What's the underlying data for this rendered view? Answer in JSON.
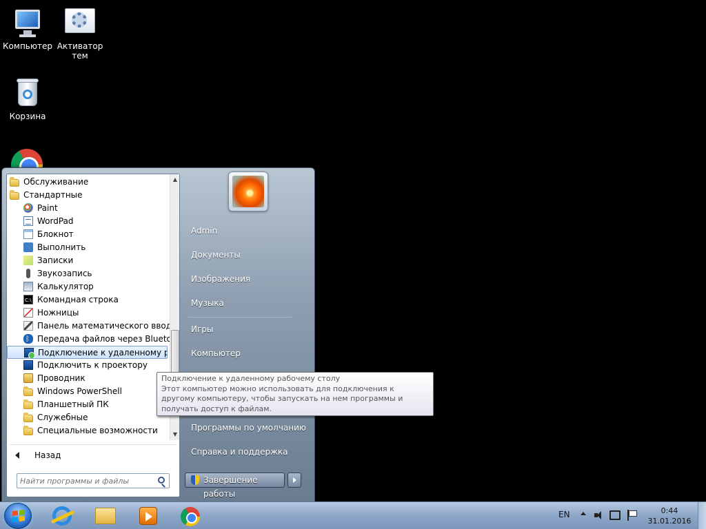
{
  "desktop": {
    "icons": [
      {
        "label": "Компьютер"
      },
      {
        "label": "Активатор тем"
      },
      {
        "label": "Корзина"
      }
    ]
  },
  "start_menu": {
    "programs": [
      {
        "label": "Обслуживание",
        "icon": "folder-icon",
        "level": 0
      },
      {
        "label": "Стандартные",
        "icon": "folder-icon",
        "level": 0
      },
      {
        "label": "Paint",
        "icon": "paint-icon",
        "level": 1
      },
      {
        "label": "WordPad",
        "icon": "wordpad-icon",
        "level": 1
      },
      {
        "label": "Блокнот",
        "icon": "notepad-icon",
        "level": 1
      },
      {
        "label": "Выполнить",
        "icon": "run-icon",
        "level": 1
      },
      {
        "label": "Записки",
        "icon": "sticky-notes-icon",
        "level": 1
      },
      {
        "label": "Звукозапись",
        "icon": "microphone-icon",
        "level": 1
      },
      {
        "label": "Калькулятор",
        "icon": "calculator-icon",
        "level": 1
      },
      {
        "label": "Командная строка",
        "icon": "command-prompt-icon",
        "level": 1
      },
      {
        "label": "Ножницы",
        "icon": "snipping-tool-icon",
        "level": 1
      },
      {
        "label": "Панель математического ввода",
        "icon": "math-input-icon",
        "level": 1
      },
      {
        "label": "Передача файлов через Bluetooth",
        "icon": "bluetooth-icon",
        "level": 1
      },
      {
        "label": "Подключение к удаленному рабочему столу",
        "icon": "remote-desktop-icon",
        "level": 1,
        "selected": true
      },
      {
        "label": "Подключить к проектору",
        "icon": "projector-icon",
        "level": 1
      },
      {
        "label": "Проводник",
        "icon": "explorer-icon",
        "level": 1
      },
      {
        "label": "Windows PowerShell",
        "icon": "folder-icon",
        "level": 1
      },
      {
        "label": "Планшетный ПК",
        "icon": "folder-icon",
        "level": 1
      },
      {
        "label": "Служебные",
        "icon": "folder-icon",
        "level": 1
      },
      {
        "label": "Специальные возможности",
        "icon": "folder-icon",
        "level": 1
      }
    ],
    "back_label": "Назад",
    "search_placeholder": "Найти программы и файлы",
    "right_items": [
      "Admin",
      "Документы",
      "Изображения",
      "Музыка",
      "Игры",
      "Компьютер",
      "Программы по умолчанию",
      "Справка и поддержка"
    ],
    "shutdown_label": "Завершение работы"
  },
  "tooltip": {
    "title": "Подключение к удаленному рабочему столу",
    "body": "Этот компьютер можно использовать для подключения к другому компьютеру, чтобы запускать на нем программы и получать доступ к файлам."
  },
  "taskbar": {
    "language": "EN",
    "time": "0:44",
    "date": "31.01.2016",
    "pinned": [
      "internet-explorer-icon",
      "file-explorer-icon",
      "media-player-icon",
      "chrome-icon"
    ]
  }
}
